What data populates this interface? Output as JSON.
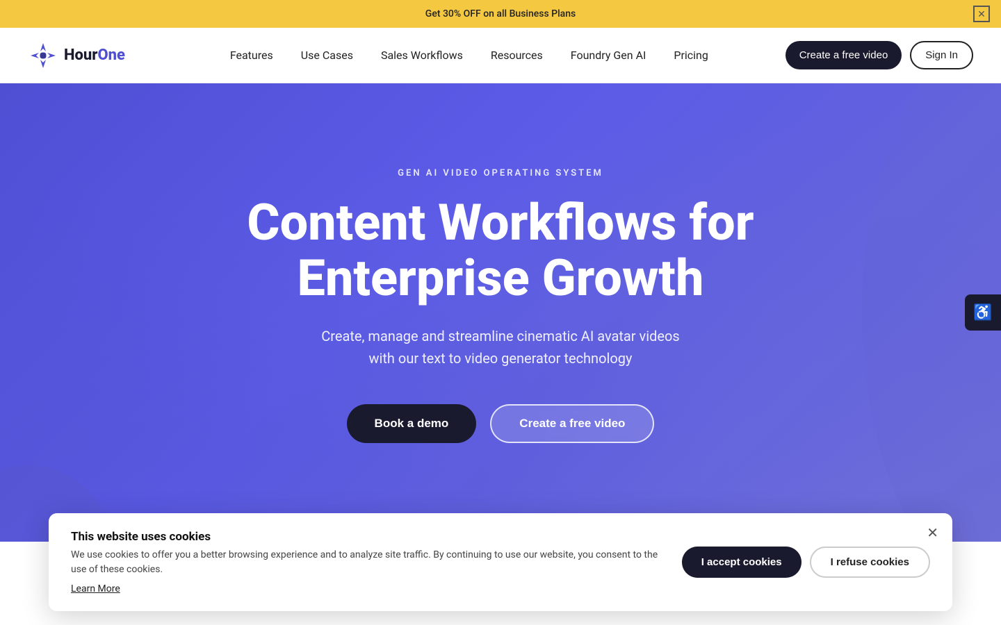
{
  "banner": {
    "text": "Get 30% OFF on all Business Plans",
    "close_label": "✕"
  },
  "navbar": {
    "logo_name": "Hour",
    "logo_name2": "One",
    "nav_items": [
      {
        "label": "Features",
        "id": "features"
      },
      {
        "label": "Use Cases",
        "id": "use-cases"
      },
      {
        "label": "Sales Workflows",
        "id": "sales-workflows"
      },
      {
        "label": "Resources",
        "id": "resources"
      },
      {
        "label": "Foundry Gen AI",
        "id": "foundry-gen-ai"
      },
      {
        "label": "Pricing",
        "id": "pricing"
      }
    ],
    "cta_label": "Create a free video",
    "signin_label": "Sign In"
  },
  "hero": {
    "eyebrow": "GEN AI VIDEO OPERATING SYSTEM",
    "title_line1": "Content Workflows for",
    "title_line2": "Enterprise Growth",
    "subtitle_line1": "Create, manage and streamline cinematic AI avatar videos",
    "subtitle_line2": "with our text to video generator technology",
    "book_demo_label": "Book a demo",
    "create_video_label": "Create a free video"
  },
  "cookie": {
    "title": "This website uses cookies",
    "description": "We use cookies to offer you a better browsing experience and to analyze site traffic. By continuing to use our website, you consent to the use of these cookies.",
    "learn_more_label": "Learn More",
    "accept_label": "I accept cookies",
    "refuse_label": "I refuse cookies",
    "close_label": "✕"
  },
  "accessibility": {
    "icon": "♿",
    "label": "Accessibility"
  },
  "colors": {
    "hero_bg": "#5555e0",
    "dark": "#1a1a2e",
    "banner_bg": "#f5c842"
  }
}
